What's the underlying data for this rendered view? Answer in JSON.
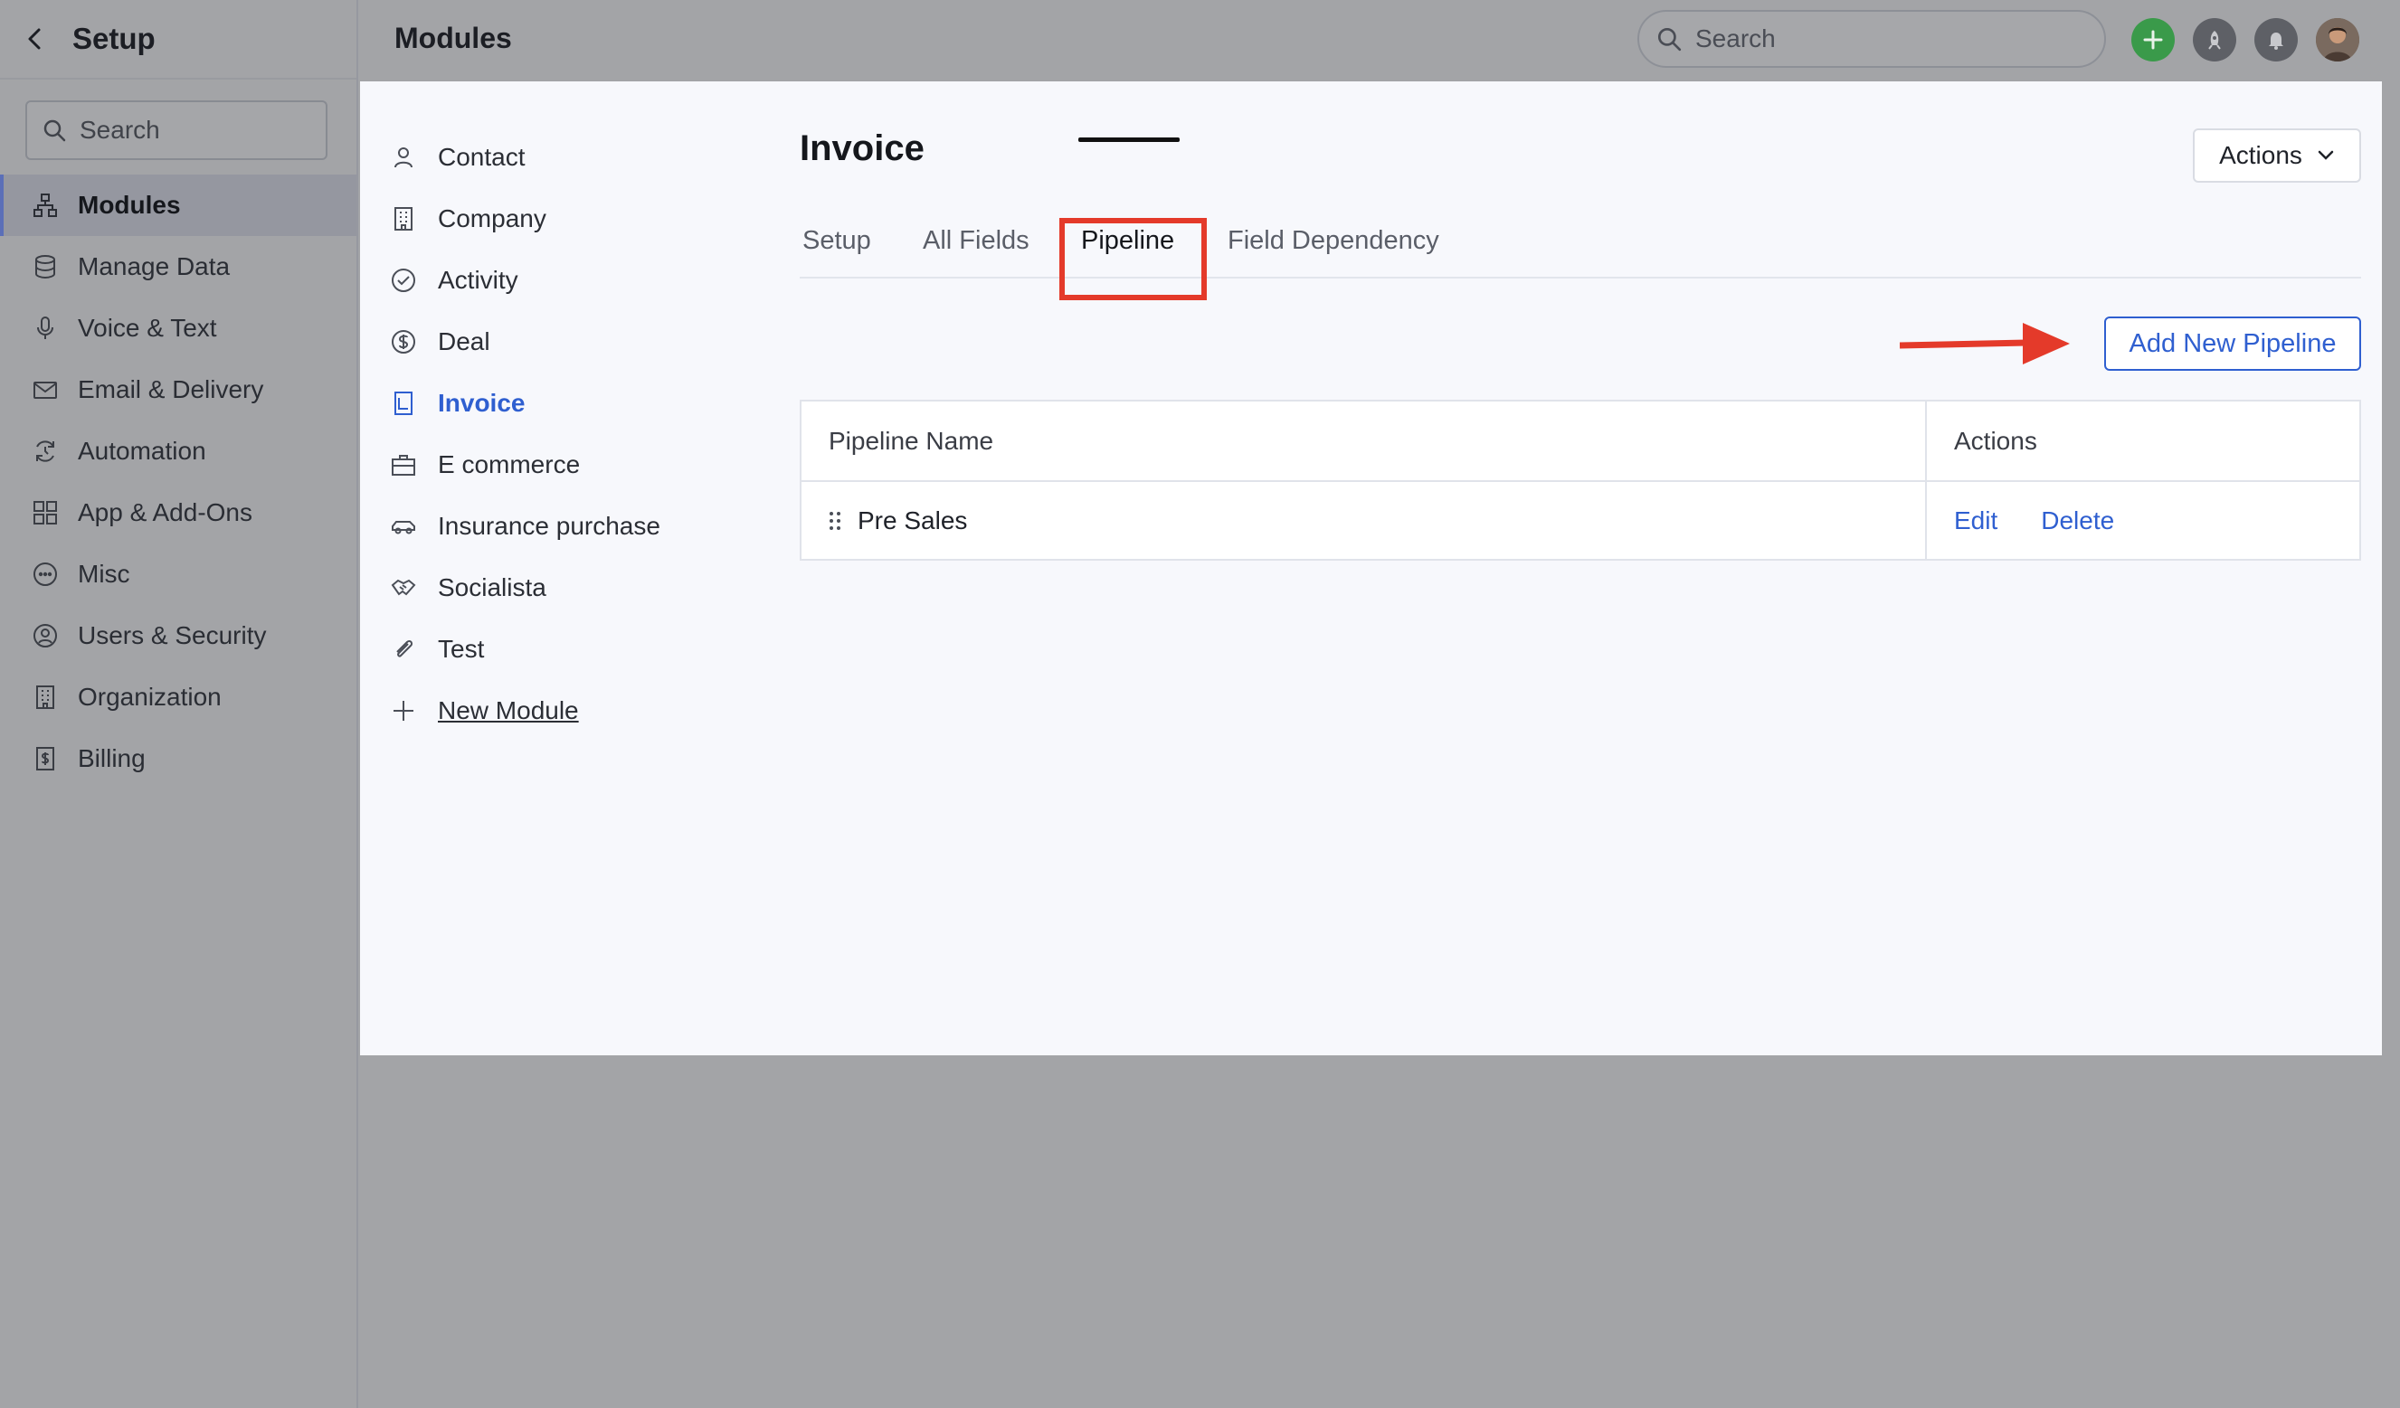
{
  "sidebar": {
    "title": "Setup",
    "search_placeholder": "Search",
    "items": [
      {
        "label": "Modules",
        "icon": "modules-icon",
        "active": true
      },
      {
        "label": "Manage Data",
        "icon": "database-icon"
      },
      {
        "label": "Voice & Text",
        "icon": "microphone-icon"
      },
      {
        "label": "Email & Delivery",
        "icon": "envelope-icon"
      },
      {
        "label": "Automation",
        "icon": "automation-icon"
      },
      {
        "label": "App & Add-Ons",
        "icon": "grid-icon"
      },
      {
        "label": "Misc",
        "icon": "ellipsis-circle-icon"
      },
      {
        "label": "Users & Security",
        "icon": "user-circle-icon"
      },
      {
        "label": "Organization",
        "icon": "building-icon"
      },
      {
        "label": "Billing",
        "icon": "billing-icon"
      }
    ]
  },
  "topbar": {
    "title": "Modules",
    "search_placeholder": "Search"
  },
  "modules": {
    "items": [
      {
        "label": "Contact"
      },
      {
        "label": "Company"
      },
      {
        "label": "Activity"
      },
      {
        "label": "Deal"
      },
      {
        "label": "Invoice",
        "active": true
      },
      {
        "label": "E commerce"
      },
      {
        "label": "Insurance purchase"
      },
      {
        "label": "Socialista"
      },
      {
        "label": "Test"
      },
      {
        "label": "New Module"
      }
    ]
  },
  "content": {
    "title": "Invoice",
    "actions_label": "Actions",
    "tabs": [
      {
        "label": "Setup"
      },
      {
        "label": "All Fields"
      },
      {
        "label": "Pipeline",
        "active": true
      },
      {
        "label": "Field Dependency"
      }
    ],
    "add_button": "Add New Pipeline",
    "table": {
      "headers": [
        "Pipeline Name",
        "Actions"
      ],
      "rows": [
        {
          "name": "Pre Sales",
          "edit": "Edit",
          "delete": "Delete"
        }
      ]
    }
  },
  "colors": {
    "accent": "#2f5fd0",
    "highlight": "#e43a2a",
    "add_button_green": "#3a9a4a"
  }
}
